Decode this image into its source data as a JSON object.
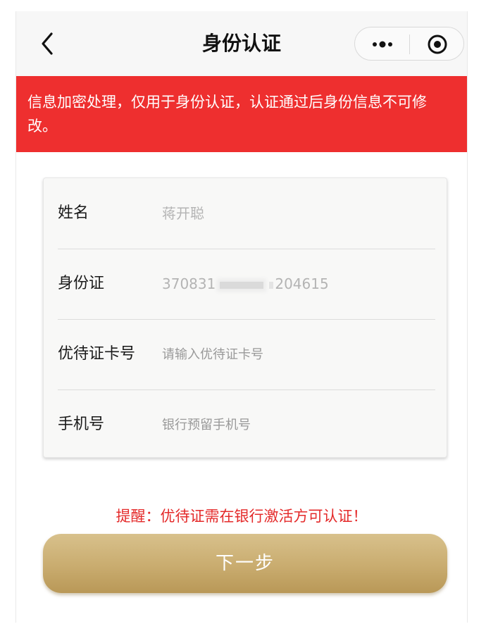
{
  "navbar": {
    "title": "身份认证",
    "back_icon": "chevron-left-icon",
    "more_icon": "more-dots-icon",
    "close_icon": "target-icon"
  },
  "notice": {
    "text": "信息加密处理，仅用于身份认证，认证通过后身份信息不可修改。",
    "background": "#ee2f2f"
  },
  "form": {
    "name": {
      "label": "姓名",
      "value": "蒋开聪"
    },
    "id_card": {
      "label": "身份证",
      "value_prefix": "370831",
      "value_suffix": "204615"
    },
    "card_number": {
      "label": "优待证卡号",
      "placeholder": "请输入优待证卡号"
    },
    "phone": {
      "label": "手机号",
      "placeholder": "银行预留手机号"
    }
  },
  "reminder": {
    "text": "提醒：优待证需在银行激活方可认证！",
    "color": "#e42a2a"
  },
  "next_button": {
    "label": "下一步",
    "accent": "#c9ac6f"
  }
}
